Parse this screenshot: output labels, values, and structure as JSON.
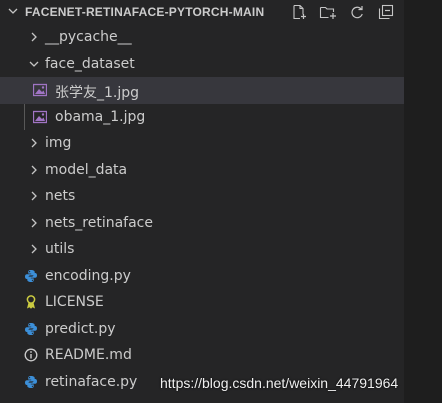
{
  "explorer": {
    "title": "FACENET-RETINAFACE-PYTORCH-MAIN",
    "actions": [
      {
        "name": "new-file-icon"
      },
      {
        "name": "new-folder-icon"
      },
      {
        "name": "refresh-icon"
      },
      {
        "name": "collapse-all-icon"
      }
    ]
  },
  "tree": [
    {
      "label": "__pycache__",
      "kind": "folder",
      "expanded": false,
      "depth": 0,
      "icon": "chevron-right-icon"
    },
    {
      "label": "face_dataset",
      "kind": "folder",
      "expanded": true,
      "depth": 0,
      "icon": "chevron-down-icon"
    },
    {
      "label": "张学友_1.jpg",
      "kind": "file",
      "depth": 1,
      "icon": "image-file-icon",
      "selected": true
    },
    {
      "label": "obama_1.jpg",
      "kind": "file",
      "depth": 1,
      "icon": "image-file-icon"
    },
    {
      "label": "img",
      "kind": "folder",
      "expanded": false,
      "depth": 0,
      "icon": "chevron-right-icon"
    },
    {
      "label": "model_data",
      "kind": "folder",
      "expanded": false,
      "depth": 0,
      "icon": "chevron-right-icon"
    },
    {
      "label": "nets",
      "kind": "folder",
      "expanded": false,
      "depth": 0,
      "icon": "chevron-right-icon"
    },
    {
      "label": "nets_retinaface",
      "kind": "folder",
      "expanded": false,
      "depth": 0,
      "icon": "chevron-right-icon"
    },
    {
      "label": "utils",
      "kind": "folder",
      "expanded": false,
      "depth": 0,
      "icon": "chevron-right-icon"
    },
    {
      "label": "encoding.py",
      "kind": "file",
      "depth": 0,
      "icon": "python-file-icon"
    },
    {
      "label": "LICENSE",
      "kind": "file",
      "depth": 0,
      "icon": "license-file-icon"
    },
    {
      "label": "predict.py",
      "kind": "file",
      "depth": 0,
      "icon": "python-file-icon"
    },
    {
      "label": "README.md",
      "kind": "file",
      "depth": 0,
      "icon": "info-file-icon"
    },
    {
      "label": "retinaface.py",
      "kind": "file",
      "depth": 0,
      "icon": "python-file-icon"
    }
  ],
  "watermark": "https://blog.csdn.net/weixin_44791964",
  "colors": {
    "background": "#252526",
    "selection": "#37373d",
    "text": "#cccccc",
    "python": "#3c8fd8",
    "image": "#a074c4",
    "license": "#cbcb41"
  }
}
